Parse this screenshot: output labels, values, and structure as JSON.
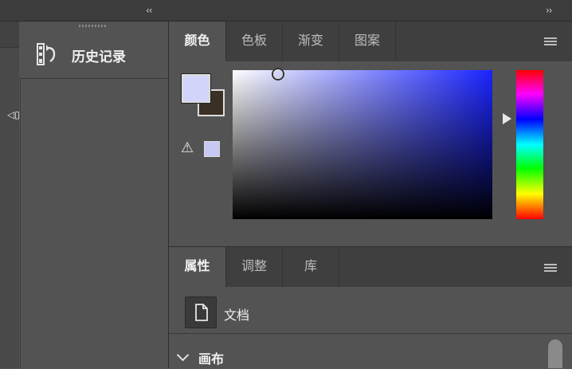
{
  "top_bar": {
    "collapse_left": "‹‹",
    "collapse_right": "››"
  },
  "left_strip": {
    "handle": "◁▯▷"
  },
  "history_panel": {
    "label": "历史记录",
    "icon": "history-icon"
  },
  "color_panel": {
    "tabs": [
      {
        "label": "颜色",
        "active": true
      },
      {
        "label": "色板",
        "active": false
      },
      {
        "label": "渐变",
        "active": false
      },
      {
        "label": "图案",
        "active": false
      }
    ],
    "foreground_color": "#d3d4fa",
    "background_color": "#3a3024",
    "gamut_warning_icon": "warning-icon",
    "gamut_color": "#c8c8f4"
  },
  "properties_panel": {
    "tabs": [
      {
        "label": "属性",
        "active": true
      },
      {
        "label": "调整",
        "active": false
      },
      {
        "label": "库",
        "active": false
      }
    ],
    "document_label": "文档",
    "section_label": "画布"
  }
}
